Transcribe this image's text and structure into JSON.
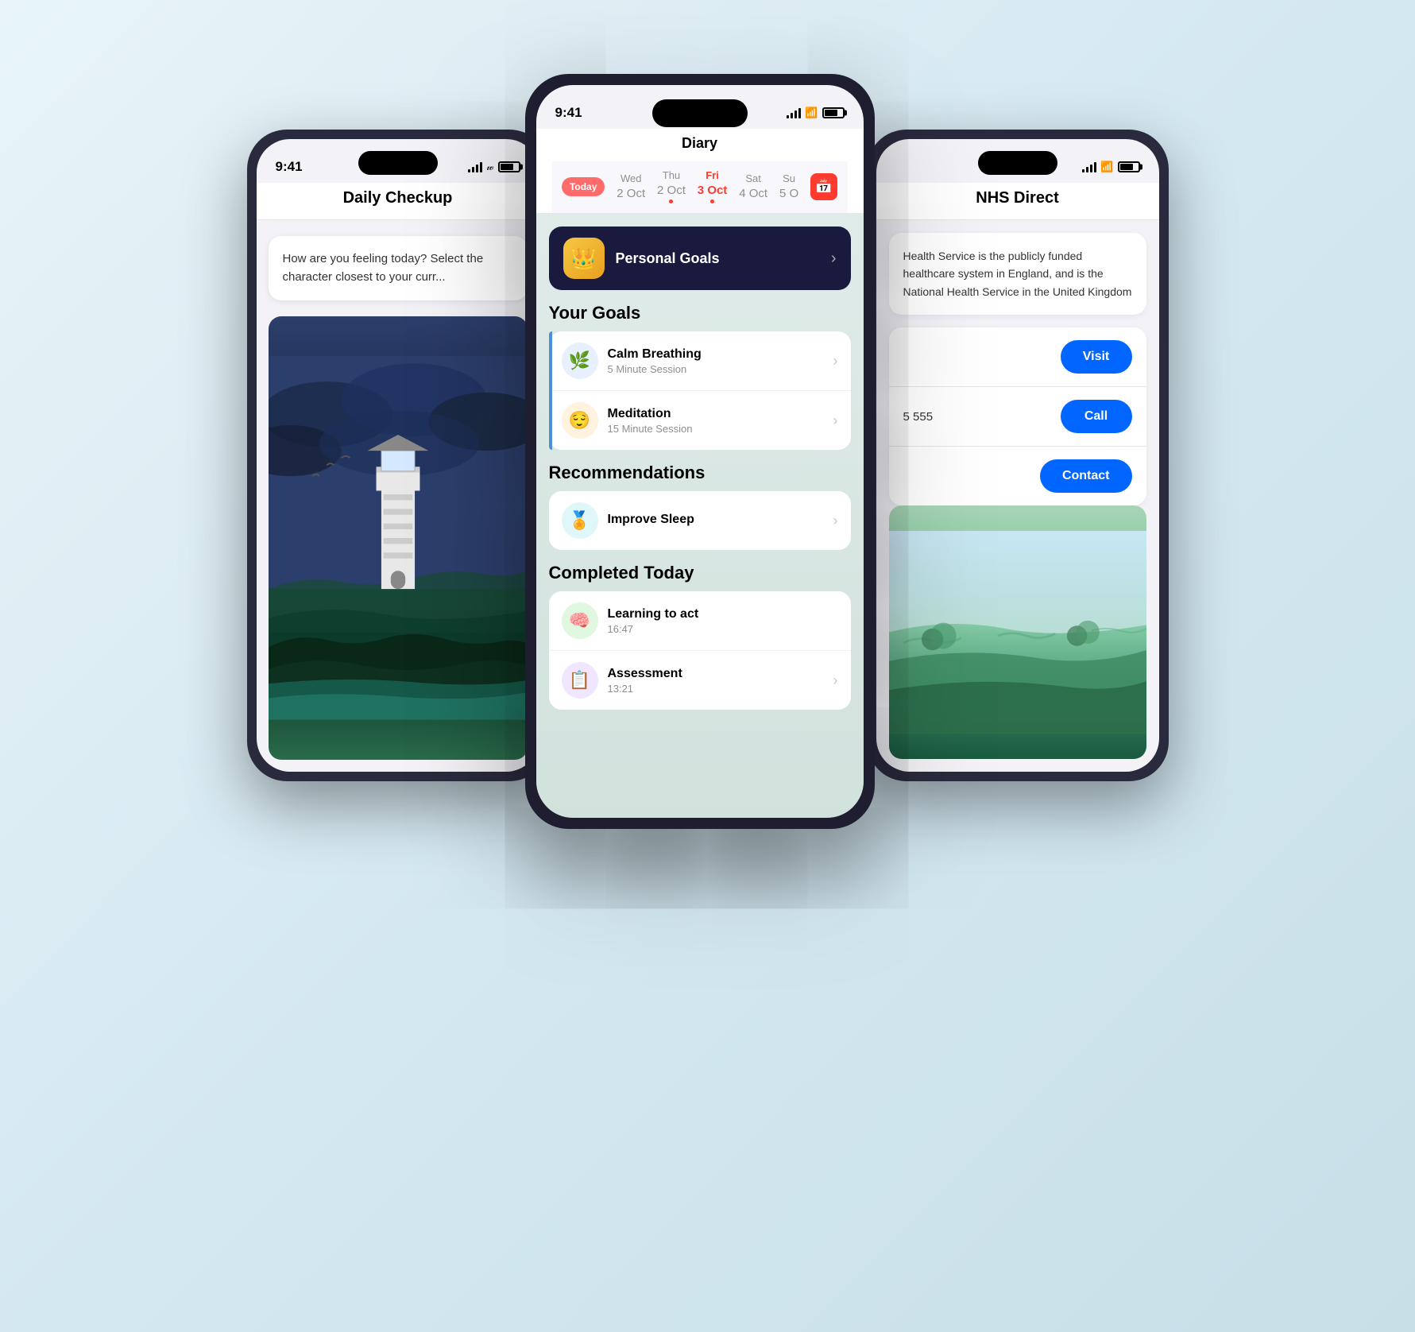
{
  "left_phone": {
    "status_time": "9:41",
    "title": "Daily Checkup",
    "chat_text": "How are you feeling today? Select the character closest to your curr..."
  },
  "center_phone": {
    "status_time": "9:41",
    "title": "Diary",
    "calendar": {
      "today_label": "Today",
      "days": [
        {
          "name": "Wed",
          "num": "2 Oct",
          "active": false,
          "dot": false
        },
        {
          "name": "Thu",
          "num": "2 Oct",
          "active": false,
          "dot": true
        },
        {
          "name": "Fri",
          "num": "3 Oct",
          "active": true,
          "dot": true
        },
        {
          "name": "Sat",
          "num": "4 Oct",
          "active": false,
          "dot": false
        },
        {
          "name": "Su",
          "num": "5 O",
          "active": false,
          "dot": false
        }
      ]
    },
    "personal_goals": {
      "icon": "👑",
      "label": "Personal Goals",
      "chevron": ">"
    },
    "your_goals_title": "Your Goals",
    "goals": [
      {
        "name": "Calm Breathing",
        "sub": "5 Minute Session",
        "icon": "🌿",
        "icon_class": "goal-icon-blue"
      },
      {
        "name": "Meditation",
        "sub": "15 Minute Session",
        "icon": "🙂",
        "icon_class": "goal-icon-orange"
      }
    ],
    "recommendations_title": "Recommendations",
    "recommendations": [
      {
        "name": "Improve Sleep",
        "sub": "",
        "icon": "🏅",
        "icon_class": "goal-icon-teal"
      }
    ],
    "completed_title": "Completed Today",
    "completed": [
      {
        "name": "Learning to act",
        "sub": "16:47",
        "icon": "🧠",
        "icon_class": "goal-icon-green"
      },
      {
        "name": "Assessment",
        "sub": "13:21",
        "icon": "📋",
        "icon_class": "goal-icon-purple"
      }
    ]
  },
  "right_phone": {
    "status_time": "9:41",
    "title": "NHS Direct",
    "description": "Health Service is the publicly funded healthcare system in England, and is the National Health Service in the United Kingdom",
    "actions": [
      {
        "label": "Visit",
        "type": "visit"
      },
      {
        "label": "Call",
        "phone": "5 555"
      },
      {
        "label": "Contact",
        "type": "contact"
      }
    ]
  }
}
